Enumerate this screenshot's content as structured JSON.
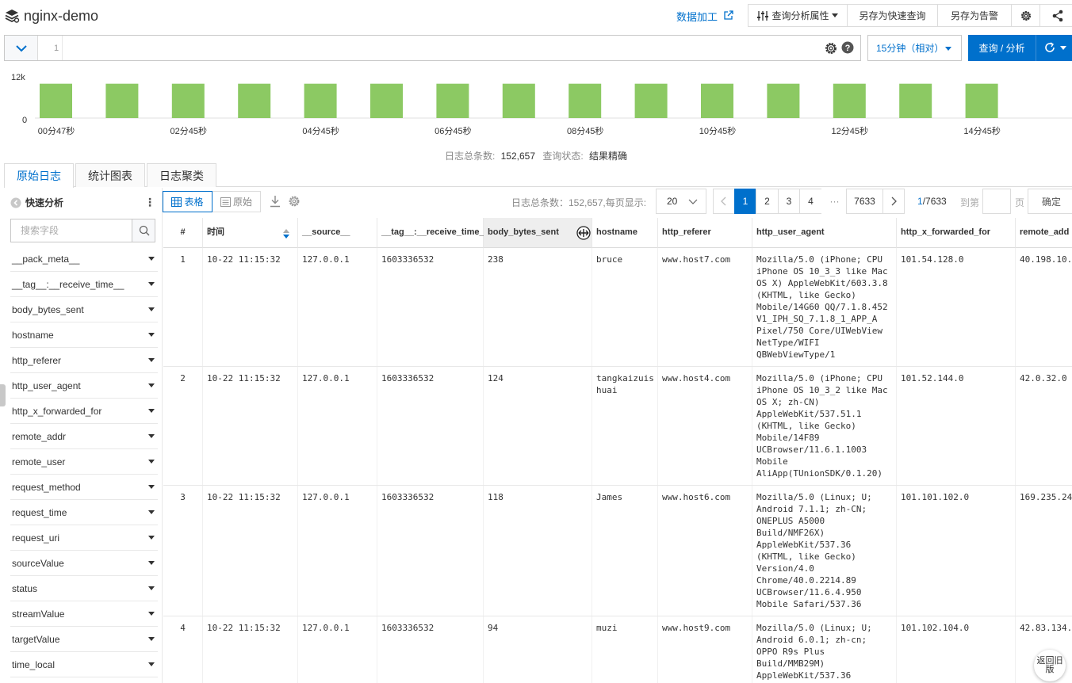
{
  "header": {
    "title": "nginx-demo",
    "data_process": "数据加工",
    "query_props": "查询分析属性",
    "save_query": "另存为快速查询",
    "save_alert": "另存为告警"
  },
  "query": {
    "line_number": "1",
    "value": "",
    "time_range": "15分钟（相对）",
    "search_label": "查询 / 分析"
  },
  "histogram": {
    "y_max": "12k",
    "y_min": "0",
    "x_labels": [
      "00分47秒",
      "02分45秒",
      "04分45秒",
      "06分45秒",
      "08分45秒",
      "10分45秒",
      "12分45秒",
      "14分45秒"
    ],
    "bar_color": "#8cc963",
    "values": [
      10000,
      10000,
      10000,
      10000,
      10000,
      10000,
      10000,
      10000,
      10000,
      10000,
      10000,
      10000,
      10000,
      10000,
      10000,
      0
    ]
  },
  "summary": {
    "total_label": "日志总条数:",
    "total_value": "152,657",
    "status_label": "查询状态:",
    "status_value": "结果精确"
  },
  "tabs": [
    {
      "label": "原始日志",
      "active": true
    },
    {
      "label": "统计图表",
      "active": false
    },
    {
      "label": "日志聚类",
      "active": false
    }
  ],
  "sidebar": {
    "title": "快速分析",
    "search_placeholder": "搜索字段",
    "fields": [
      "__pack_meta__",
      "__tag__:__receive_time__",
      "body_bytes_sent",
      "hostname",
      "http_referer",
      "http_user_agent",
      "http_x_forwarded_for",
      "remote_addr",
      "remote_user",
      "request_method",
      "request_time",
      "request_uri",
      "sourceValue",
      "status",
      "streamValue",
      "targetValue",
      "time_local"
    ]
  },
  "toolbar": {
    "table_label": "表格",
    "raw_label": "原始",
    "page_info": "日志总条数：152,657,每页显示:",
    "page_size": "20",
    "pages": [
      "1",
      "2",
      "3",
      "4",
      "···",
      "7633"
    ],
    "current_page": "1",
    "total_pages": "/7633",
    "goto_label": "到第",
    "page_label": "页",
    "confirm_label": "确定"
  },
  "table": {
    "columns": [
      "#",
      "时间",
      "__source__",
      "__tag__:__receive_time__",
      "body_bytes_sent",
      "hostname",
      "http_referer",
      "http_user_agent",
      "http_x_forwarded_for",
      "remote_add"
    ],
    "rows": [
      {
        "num": "1",
        "time": "10-22 11:15:32",
        "source": "127.0.0.1",
        "tag": "1603336532",
        "bytes": "238",
        "hostname": "bruce",
        "referer": "www.host7.com",
        "ua": "Mozilla/5.0 (iPhone; CPU\niPhone OS 10_3_3 like Mac\nOS X) AppleWebKit/603.3.8\n(KHTML, like Gecko)\nMobile/14G60 QQ/7.1.8.452\nV1_IPH_SQ_7.1.8_1_APP_A\nPixel/750 Core/UIWebView\nNetType/WIFI\nQBWebViewType/1",
        "xff": "101.54.128.0",
        "remote": "40.198.10."
      },
      {
        "num": "2",
        "time": "10-22 11:15:32",
        "source": "127.0.0.1",
        "tag": "1603336532",
        "bytes": "124",
        "hostname": "tangkaizuis\nhuai",
        "referer": "www.host4.com",
        "ua": "Mozilla/5.0 (iPhone; CPU\niPhone OS 10_3_2 like Mac\nOS X; zh-CN)\nAppleWebKit/537.51.1\n(KHTML, like Gecko)\nMobile/14F89\nUCBrowser/11.6.1.1003\nMobile\nAliApp(TUnionSDK/0.1.20)",
        "xff": "101.52.144.0",
        "remote": "42.0.32.0"
      },
      {
        "num": "3",
        "time": "10-22 11:15:32",
        "source": "127.0.0.1",
        "tag": "1603336532",
        "bytes": "118",
        "hostname": "James",
        "referer": "www.host6.com",
        "ua": "Mozilla/5.0 (Linux; U;\nAndroid 7.1.1; zh-CN;\nONEPLUS A5000\nBuild/NMF26X)\nAppleWebKit/537.36\n(KHTML, like Gecko)\nVersion/4.0\nChrome/40.0.2214.89\nUCBrowser/11.6.4.950\nMobile Safari/537.36",
        "xff": "101.101.102.0",
        "remote": "169.235.24"
      },
      {
        "num": "4",
        "time": "10-22 11:15:32",
        "source": "127.0.0.1",
        "tag": "1603336532",
        "bytes": "94",
        "hostname": "muzi",
        "referer": "www.host9.com",
        "ua": "Mozilla/5.0 (Linux; U;\nAndroid 6.0.1; zh-cn;\nOPPO R9s Plus\nBuild/MMB29M)\nAppleWebKit/537.36",
        "xff": "101.102.104.0",
        "remote": "42.83.134."
      }
    ]
  },
  "old_version": "返回旧版",
  "colors": {
    "accent": "#0070cc",
    "bar": "#8cc963"
  }
}
